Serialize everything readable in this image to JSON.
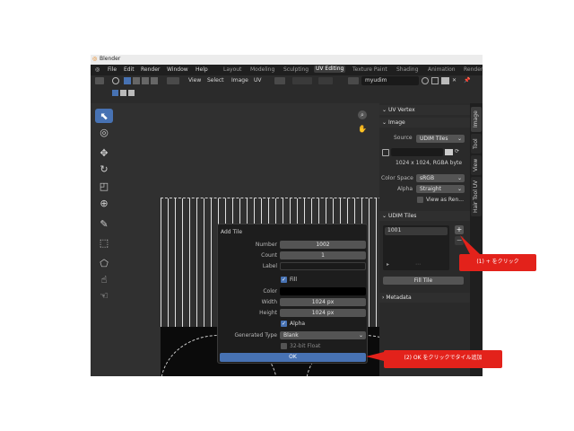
{
  "window": {
    "title": "Blender"
  },
  "menu": {
    "items": [
      "File",
      "Edit",
      "Render",
      "Window",
      "Help"
    ],
    "workspaces": [
      "Layout",
      "Modeling",
      "Sculpting",
      "UV Editing",
      "Texture Paint",
      "Shading",
      "Animation",
      "Render"
    ],
    "active_workspace": "UV Editing"
  },
  "header": {
    "menus": [
      "View",
      "Select",
      "Image",
      "UV"
    ],
    "image_name": "myudim"
  },
  "dialog": {
    "title": "Add Tile",
    "number_label": "Number",
    "number_value": "1002",
    "count_label": "Count",
    "count_value": "1",
    "label_label": "Label",
    "label_value": "",
    "fill_label": "Fill",
    "color_label": "Color",
    "width_label": "Width",
    "width_value": "1024 px",
    "height_label": "Height",
    "height_value": "1024 px",
    "alpha_label": "Alpha",
    "generated_type_label": "Generated Type",
    "generated_type_value": "Blank",
    "float_label": "32-bit Float",
    "ok_label": "OK"
  },
  "sidebar": {
    "uv_vertex": "UV Vertex",
    "image_panel": "Image",
    "source_label": "Source",
    "source_value": "UDIM Tiles",
    "resolution": "1024 x 1024,  RGBA byte",
    "color_space_label": "Color Space",
    "color_space_value": "sRGB",
    "alpha_label": "Alpha",
    "alpha_value": "Straight",
    "view_as_render": "View as Ren...",
    "udim_panel": "UDIM Tiles",
    "tile_item": "1001",
    "fill_tile_button": "Fill Tile",
    "metadata_panel": "Metadata",
    "tabs": [
      "Image",
      "Tool",
      "View",
      "Hair Tool UV"
    ]
  },
  "annotations": {
    "step1": "(1) + をクリック",
    "step2": "(2) OK をクリックでタイル追加"
  },
  "colors": {
    "accent": "#4772b3",
    "callout": "#e3221b"
  }
}
